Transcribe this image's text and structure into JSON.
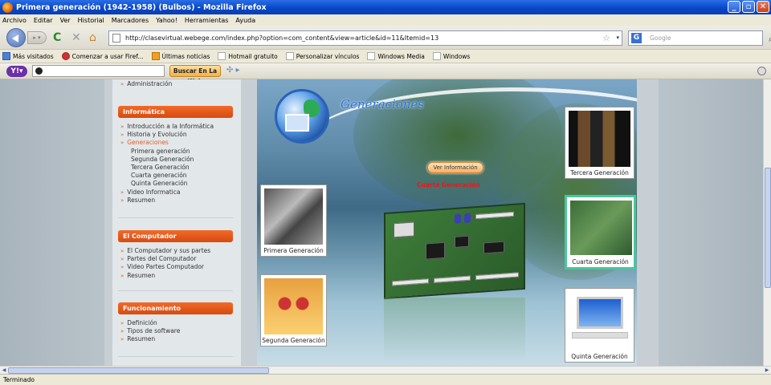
{
  "window": {
    "title": "Primera generación (1942-1958) (Bulbos) - Mozilla Firefox"
  },
  "menu": [
    "Archivo",
    "Editar",
    "Ver",
    "Historial",
    "Marcadores",
    "Yahoo!",
    "Herramientas",
    "Ayuda"
  ],
  "url": "http://clasevirtual.webege.com/index.php?option=com_content&view=article&id=11&Itemid=13",
  "search_placeholder": "Google",
  "bookmarks": [
    "Más visitados",
    "Comenzar a usar Firef...",
    "Últimas noticias",
    "Hotmail gratuito",
    "Personalizar vínculos",
    "Windows Media",
    "Windows"
  ],
  "yahoo": {
    "search_button": "Buscar En La Web"
  },
  "sidebar": {
    "partial_item": "Administración",
    "sections": [
      {
        "title": "Informática",
        "items": [
          {
            "label": "Introducción a la Informática",
            "level": 0
          },
          {
            "label": "Historia y Evolución",
            "level": 0
          },
          {
            "label": "Generaciones",
            "level": 0,
            "active": true
          },
          {
            "label": "Primera generación",
            "level": 1
          },
          {
            "label": "Segunda Generación",
            "level": 1
          },
          {
            "label": "Tercera Generación",
            "level": 1
          },
          {
            "label": "Cuarta generación",
            "level": 1
          },
          {
            "label": "Quinta Generación",
            "level": 1
          },
          {
            "label": "Video Informatica",
            "level": 0
          },
          {
            "label": "Resumen",
            "level": 0
          }
        ]
      },
      {
        "title": "El Computador",
        "items": [
          {
            "label": "El Computador y sus partes",
            "level": 0
          },
          {
            "label": "Partes del Computador",
            "level": 0
          },
          {
            "label": "Video Partes Computador",
            "level": 0
          },
          {
            "label": "Resumen",
            "level": 0
          }
        ]
      },
      {
        "title": "Funcionamiento",
        "items": [
          {
            "label": "Definición",
            "level": 0
          },
          {
            "label": "Tipos de software",
            "level": 0
          },
          {
            "label": "Resumen",
            "level": 0
          }
        ]
      }
    ]
  },
  "main": {
    "logo_text": "Generaciones",
    "info_button": "Ver Información",
    "highlight_label": "Cuarta Generación",
    "cards": {
      "primera": "Primera Generación",
      "segunda": "Segunda Generación",
      "tercera": "Tercera Generación",
      "cuarta": "Cuarta Generación",
      "quinta": "Quinta Generación"
    }
  },
  "status": "Terminado"
}
